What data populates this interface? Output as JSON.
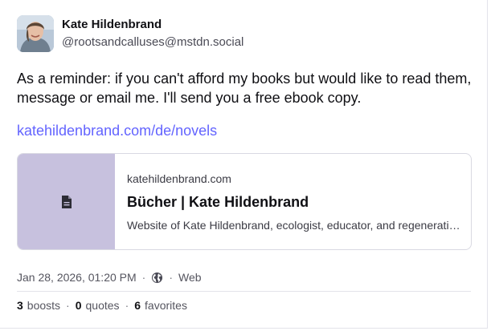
{
  "author": {
    "display_name": "Kate Hildenbrand",
    "handle": "@rootsandcalluses@mstdn.social"
  },
  "post": {
    "text": "As a reminder: if you can't afford my books but would like to read them, message or email me. I'll send you a free ebook copy.",
    "link_text": "katehildenbrand.com/de/novels"
  },
  "card": {
    "domain": "katehildenbrand.com",
    "title": "Bücher | Kate Hildenbrand",
    "description": "Website of Kate Hildenbrand, ecologist, educator, and regenerativ…",
    "thumb_icon": "document-icon",
    "thumb_color": "#c7c1de"
  },
  "meta": {
    "timestamp": "Jan 28, 2026, 01:20 PM",
    "visibility_icon": "globe-icon",
    "client": "Web"
  },
  "stats": {
    "boosts_count": "3",
    "boosts_label": "boosts",
    "quotes_count": "0",
    "quotes_label": "quotes",
    "favorites_count": "6",
    "favorites_label": "favorites"
  },
  "colors": {
    "link": "#6364ff",
    "text": "#101014",
    "muted": "#55555f"
  }
}
